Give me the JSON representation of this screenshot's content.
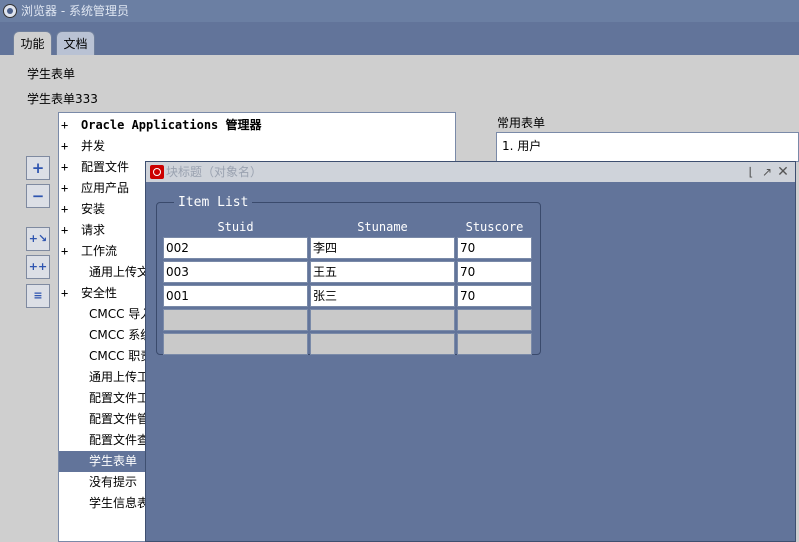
{
  "window": {
    "title": "浏览器 - 系统管理员"
  },
  "tabs": [
    {
      "label": "功能"
    },
    {
      "label": "文档"
    }
  ],
  "headings": {
    "line1": "学生表单",
    "line2": "学生表单333"
  },
  "tree": {
    "items": [
      {
        "exp": "+",
        "label": "Oracle Applications 管理器",
        "bold": true
      },
      {
        "exp": "+",
        "label": "并发"
      },
      {
        "exp": "+",
        "label": "配置文件"
      },
      {
        "exp": "+",
        "label": "应用产品"
      },
      {
        "exp": "+",
        "label": "安装"
      },
      {
        "exp": "+",
        "label": "请求"
      },
      {
        "exp": "+",
        "label": "工作流"
      },
      {
        "exp": "",
        "label": "通用上传文"
      },
      {
        "exp": "+",
        "label": "安全性"
      },
      {
        "exp": "",
        "label": "CMCC 导入"
      },
      {
        "exp": "",
        "label": "CMCC 系统"
      },
      {
        "exp": "",
        "label": "CMCC 职责"
      },
      {
        "exp": "",
        "label": "通用上传工"
      },
      {
        "exp": "",
        "label": "配置文件工"
      },
      {
        "exp": "",
        "label": "配置文件管"
      },
      {
        "exp": "",
        "label": "配置文件查"
      },
      {
        "exp": "",
        "label": "学生表单",
        "selected": true
      },
      {
        "exp": "",
        "label": "没有提示"
      },
      {
        "exp": "",
        "label": "学生信息表"
      }
    ]
  },
  "favorites": {
    "label": "常用表单",
    "items": [
      "1. 用户"
    ]
  },
  "modal": {
    "title": "块标题（对象名）",
    "group_label": "Item List",
    "columns": [
      "Stuid",
      "Stuname",
      "Stuscore"
    ],
    "rows": [
      [
        "002",
        "李四",
        "70"
      ],
      [
        "003",
        "王五",
        "70"
      ],
      [
        "001",
        "张三",
        "70"
      ]
    ],
    "empty_rows": 2
  },
  "colors": {
    "background": "#62749a",
    "panel": "#cfcfcf",
    "selection": "#62749a"
  }
}
